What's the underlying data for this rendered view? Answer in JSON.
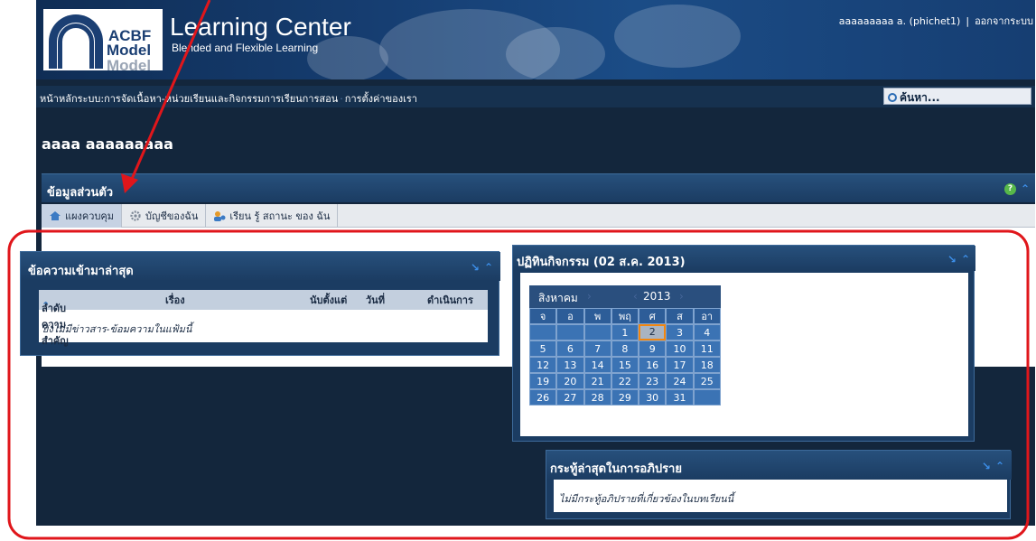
{
  "header": {
    "logo_line1": "ACBF",
    "logo_line2": "Model",
    "logo_line3": "Model",
    "title": "Learning Center",
    "subtitle": "Blended and Flexible Learning",
    "user_label": "aaaaaaaaa a. (phichet1)",
    "separator": "|",
    "logout": "ออกจากระบบ"
  },
  "nav": {
    "crumb1": "หน้าหลักระบบ:",
    "crumb2": "การจัดเนื้อหา-หน่วยเรียนและกิจกรรมการเรียนการสอน",
    "crumb3": "การตั้งค่าของเรา",
    "search_label": "ค้นหา..."
  },
  "page": {
    "title": "aaaa aaaaaaaaa"
  },
  "section": {
    "title": "ข้อมูลส่วนตัว",
    "tabs": [
      {
        "label": "แผงควบคุม"
      },
      {
        "label": "บัญชีของฉัน"
      },
      {
        "label": "เรียน รู้ สถานะ ของ ฉัน"
      }
    ]
  },
  "inbox": {
    "title": "ข้อความเข้ามาล่าสุด",
    "col_priority": "ลำดับความสำคัญ",
    "col_subject": "เรื่อง",
    "col_since": "นับตั้งแต่",
    "col_date": "วันที่",
    "col_action": "ดำเนินการ",
    "empty": "ยังไม่มีข่าวสาร-ข้อมความในแฟ้มนี้"
  },
  "calendar": {
    "title": "ปฏิทินกิจกรรม (02 ส.ค. 2013)",
    "month": "สิงหาคม",
    "year": "2013",
    "weekdays": [
      "จ",
      "อ",
      "พ",
      "พฤ",
      "ศ",
      "ส",
      "อา"
    ],
    "days": [
      "",
      "",
      "",
      "1",
      "2",
      "3",
      "4",
      "5",
      "6",
      "7",
      "8",
      "9",
      "10",
      "11",
      "12",
      "13",
      "14",
      "15",
      "16",
      "17",
      "18",
      "19",
      "20",
      "21",
      "22",
      "23",
      "24",
      "25",
      "26",
      "27",
      "28",
      "29",
      "30",
      "31",
      ""
    ],
    "today": "2"
  },
  "forum": {
    "title": "กระทู้ล่าสุดในการอภิปราย",
    "empty": "ไม่มีกระทู้อภิปรายที่เกี่ยวข้องในบทเรียนนี้"
  },
  "colors": {
    "annotation": "#e0161b",
    "banner": "#163e72",
    "panel": "#1b3c62",
    "calendar_cell": "#3b73b4",
    "today_border": "#f2860f"
  }
}
